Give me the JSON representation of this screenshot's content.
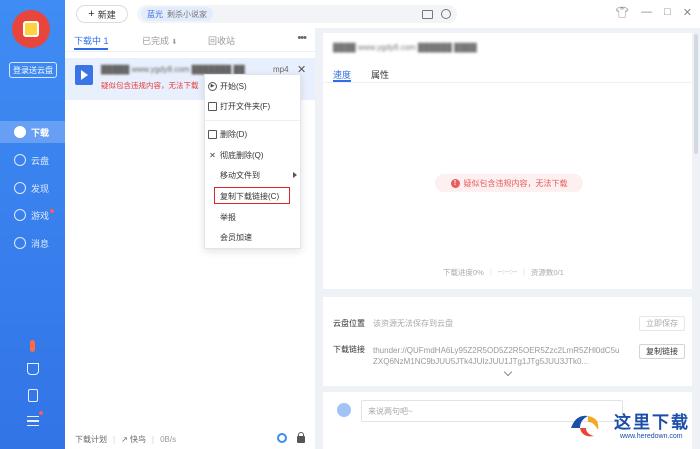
{
  "sidebar": {
    "login_label": "登录送云盘",
    "items": [
      {
        "label": "下载",
        "icon": "download-icon",
        "active": true
      },
      {
        "label": "云盘",
        "icon": "cloud-icon",
        "active": false
      },
      {
        "label": "发现",
        "icon": "discover-icon",
        "active": false
      },
      {
        "label": "游戏",
        "icon": "gamepad-icon",
        "active": false,
        "badge": true
      },
      {
        "label": "消息",
        "icon": "message-icon",
        "active": false
      }
    ]
  },
  "topbar": {
    "new_label": "新建",
    "search_chip_app": "蓝光",
    "search_chip_query": "剩杀小说家"
  },
  "tabs": {
    "downloading": "下载中 1",
    "completed": "已完成",
    "recycle": "回收站"
  },
  "download_item": {
    "name": "█████ www.ygdy8.com ███████ ██",
    "ext": "mp4",
    "warning": "疑似包含违规内容，无法下载"
  },
  "context_menu": {
    "start": "开始(S)",
    "open_folder": "打开文件夹(F)",
    "delete": "删除(D)",
    "delete_all": "彻底删除(Q)",
    "move_to": "移动文件到",
    "copy_link": "复制下载链接(C)",
    "report": "举报",
    "vip_speed": "会员加速"
  },
  "statusbar": {
    "plan": "下载计划",
    "fast": "快鸟",
    "speed": "0B/s"
  },
  "detail": {
    "title": "████ www.ygdy8.com ██████ ████",
    "tab_speed": "速度",
    "tab_props": "属性",
    "warning": "疑似包含违规内容，无法下载",
    "progress": "下载进度0%",
    "time": "--:--:--",
    "resources": "资源数0/1"
  },
  "cloud": {
    "location_label": "云盘位置",
    "location_value": "该资源无法保存到云盘",
    "save_btn": "立即保存",
    "link_label": "下载链接",
    "link_value": "thunder://QUFmdHA6Ly95Z2R5OD5Z2R5OER5Zzc2LmR5ZHl0dC5uZXQ6NzM1NC9bJUU5JTk4JUIzJUU1JTg1JTg5JUU3JTk0...",
    "copy_btn": "复制链接"
  },
  "comment": {
    "placeholder": "来说两句吧~"
  },
  "watermark": {
    "text": "这里下载",
    "url": "www.heredown.com"
  },
  "colors": {
    "accent": "#2f6ee8",
    "sidebar": "#3a80ef",
    "warning": "#e83c3c",
    "highlight_box": "#d9262b"
  }
}
